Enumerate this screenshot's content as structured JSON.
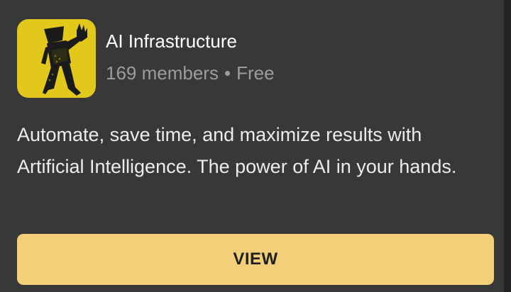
{
  "group": {
    "name": "AI Infrastructure",
    "member_count": "169 members",
    "separator": "•",
    "price": "Free",
    "description": "Automate, save time, and maximize results with Artificial Intelligence. The power of AI in your hands.",
    "logo_icon": "robot-figure-waving-icon"
  },
  "actions": {
    "view_label": "VIEW"
  },
  "colors": {
    "card_background": "#383838",
    "button_background": "#f2cf78",
    "logo_background": "#e2c81a",
    "secondary_text": "#9c9c9c"
  }
}
